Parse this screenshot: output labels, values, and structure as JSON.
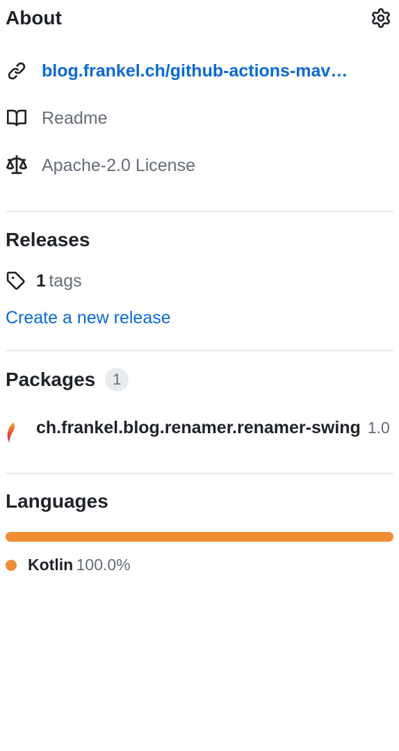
{
  "about": {
    "title": "About",
    "link": "blog.frankel.ch/github-actions-mav…",
    "readme": "Readme",
    "license": "Apache-2.0 License"
  },
  "releases": {
    "title": "Releases",
    "tag_count": "1",
    "tag_label": "tags",
    "create_link": "Create a new release"
  },
  "packages": {
    "title": "Packages",
    "count": "1",
    "items": [
      {
        "name": "ch.frankel.blog.renamer.renamer-swing",
        "version": "1.0"
      }
    ]
  },
  "languages": {
    "title": "Languages",
    "items": [
      {
        "name": "Kotlin",
        "percent": "100.0%",
        "color": "#f18e33"
      }
    ]
  }
}
